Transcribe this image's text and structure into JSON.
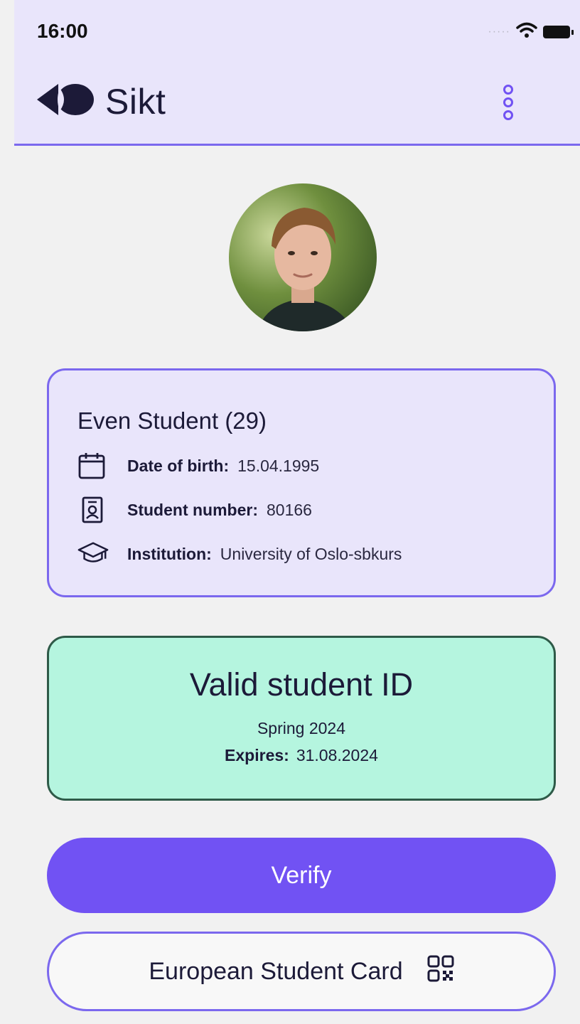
{
  "status_bar": {
    "time": "16:00",
    "signal_icon": "signal-dots-icon",
    "wifi_icon": "wifi-icon",
    "battery_icon": "battery-icon"
  },
  "header": {
    "brand": "Sikt",
    "logo_icon": "sikt-logo-icon",
    "menu_icon": "more-vertical-icon"
  },
  "profile": {
    "avatar_icon": "student-photo"
  },
  "student": {
    "name": "Even Student (29)",
    "rows": [
      {
        "icon": "calendar-icon",
        "label": "Date of birth:",
        "value": "15.04.1995"
      },
      {
        "icon": "id-card-icon",
        "label": "Student number:",
        "value": "80166"
      },
      {
        "icon": "graduation-cap-icon",
        "label": "Institution:",
        "value": "University of Oslo-sbkurs"
      }
    ]
  },
  "validity": {
    "title": "Valid student ID",
    "term": "Spring 2024",
    "expires_label": "Expires:",
    "expires_value": "31.08.2024"
  },
  "actions": {
    "verify_label": "Verify",
    "esc_label": "European Student Card",
    "esc_icon": "qr-code-icon"
  },
  "colors": {
    "accent": "#7152f3",
    "header_bg": "#e9e5fb",
    "valid_bg": "#b5f5df",
    "valid_border": "#2e5a48",
    "text": "#1c1a38"
  }
}
